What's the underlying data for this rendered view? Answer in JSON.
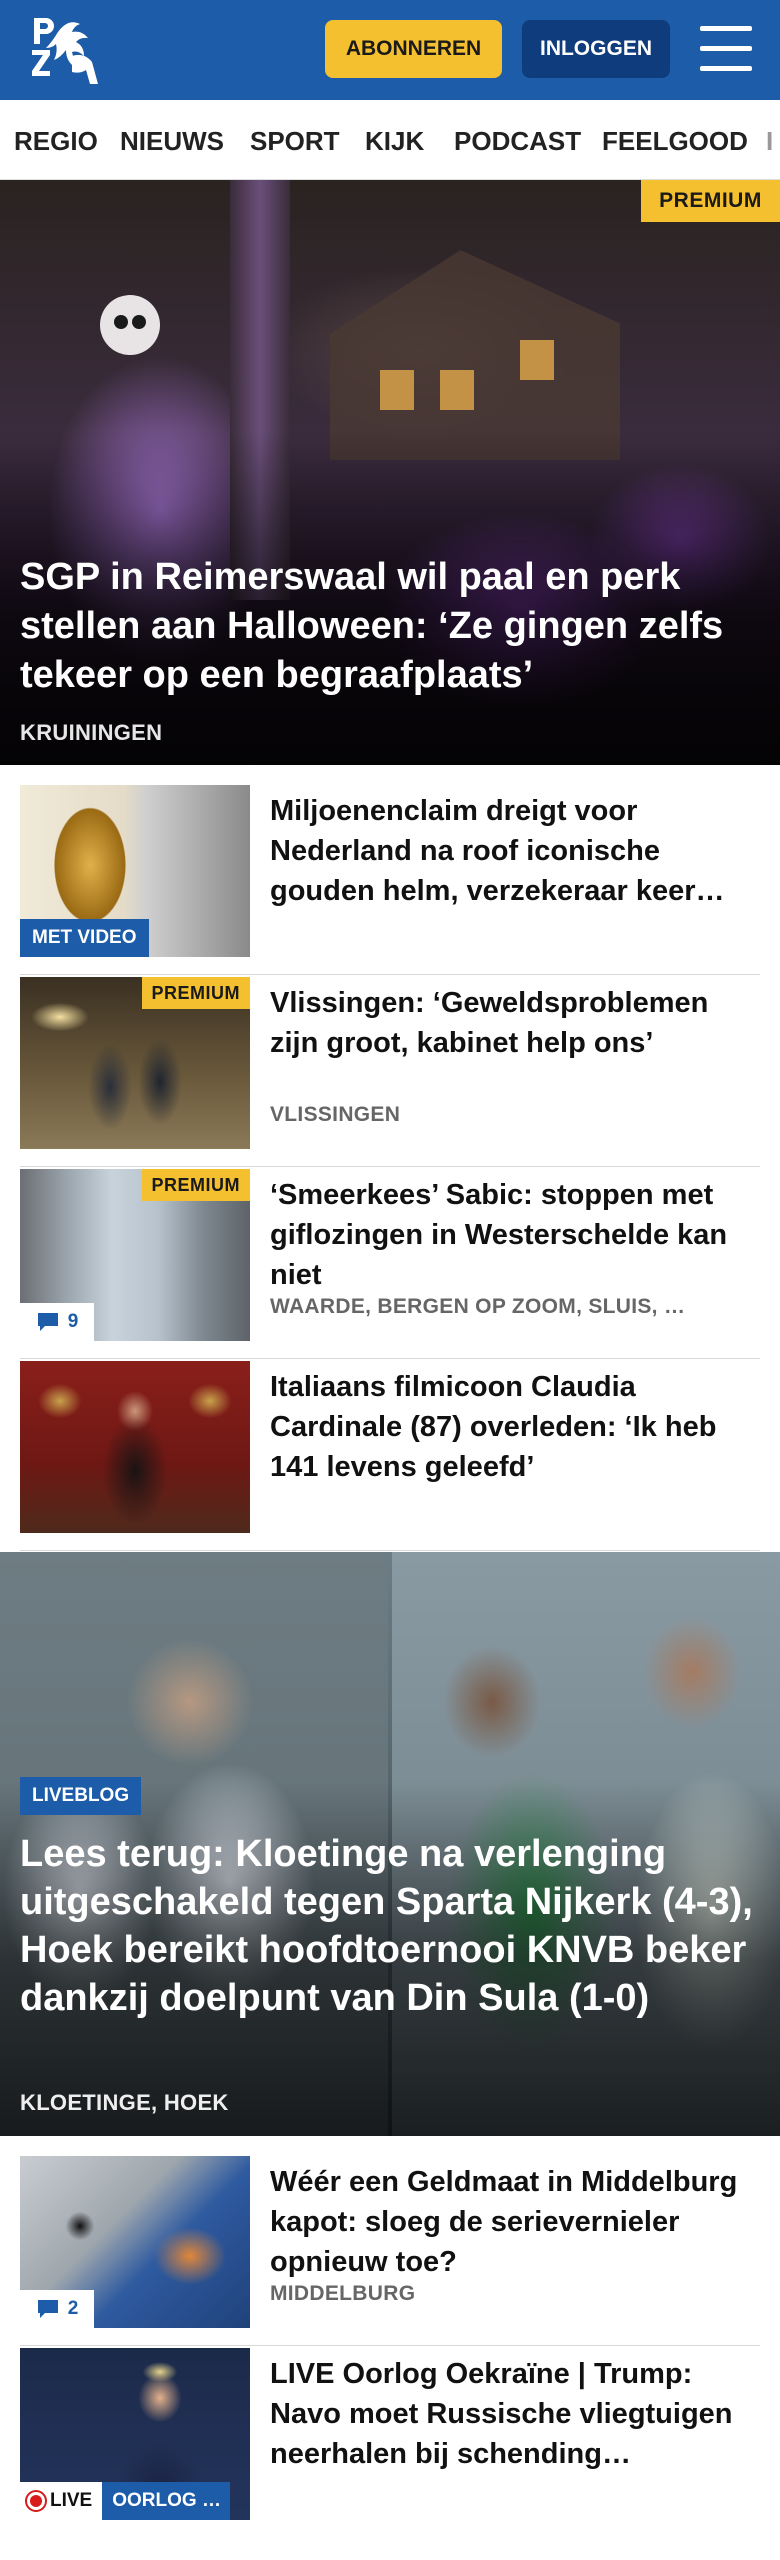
{
  "header": {
    "logo_text": "PZC",
    "subscribe_label": "ABONNEREN",
    "login_label": "INLOGGEN",
    "accent": "#1c5ca8",
    "button_yellow": "#f4c02f"
  },
  "nav": {
    "items": [
      "REGIO",
      "NIEUWS",
      "SPORT",
      "KIJK",
      "PODCAST",
      "FEELGOOD",
      "I"
    ]
  },
  "hero": {
    "badge": "PREMIUM",
    "title": "SGP in Reimerswaal wil paal en perk stellen aan Halloween: ‘Ze gingen zelfs tekeer op een begraafplaats’",
    "location": "KRUININGEN"
  },
  "articles": [
    {
      "title": "Miljoenenclaim dreigt voor Nederland na roof iconische gouden helm, verzekeraar keer…",
      "badge": "MET VIDEO",
      "location": ""
    },
    {
      "title": "Vlissingen: ‘Geweldsproblemen zijn groot, kabinet help ons’",
      "badge": "PREMIUM",
      "location": "VLISSINGEN"
    },
    {
      "title": "‘Smeerkees’ Sabic: stoppen met giflozingen in Westerschelde kan niet",
      "badge": "PREMIUM",
      "comments": "9",
      "location": "WAARDE, BERGEN OP ZOOM, SLUIS, …"
    },
    {
      "title": "Italiaans filmicoon Claudia Cardinale (87) overleden: ‘Ik heb 141 levens geleefd’",
      "location": ""
    }
  ],
  "sports_hero": {
    "badge": "LIVEBLOG",
    "title": "Lees terug: Kloetinge na verlenging uitgeschakeld tegen Sparta Nijkerk (4-3), Hoek bereikt hoofdtoernooi KNVB beker dankzij doelpunt van Din Sula (1-0)",
    "location": "KLOETINGE, HOEK"
  },
  "articles2": [
    {
      "title": "Wéér een Geldmaat in Middelburg kapot: sloeg de serievernieler opnieuw toe?",
      "comments": "2",
      "location": "MIDDELBURG"
    },
    {
      "title": "LIVE Oorlog Oekraïne | Trump: Navo moet Russische vliegtuigen neerhalen bij schending…",
      "live_label": "LIVE",
      "topic": "OORLOG …"
    }
  ]
}
